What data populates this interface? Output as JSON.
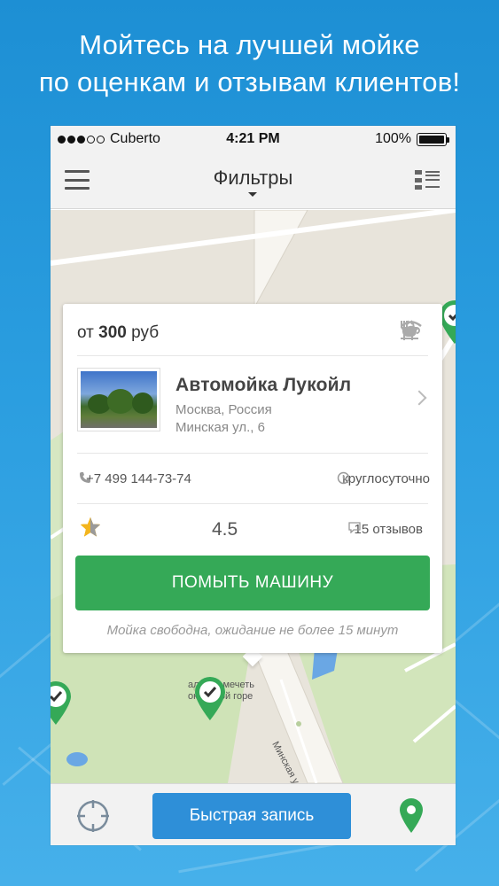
{
  "promo": {
    "line1": "Мойтесь на лучшей мойке",
    "line2": "по оценкам и отзывам клиентов!"
  },
  "statusbar": {
    "carrier": "Cuberto",
    "time": "4:21 PM",
    "battery": "100%",
    "signal_bars_filled": 3,
    "signal_bars_total": 5
  },
  "navbar": {
    "title": "Фильтры"
  },
  "card": {
    "price_prefix": "от",
    "price_value": "300",
    "price_unit": "руб",
    "amenities": [
      "restaurant-icon",
      "cafe-icon",
      "wifi-icon"
    ],
    "name": "Автомойка Лукойл",
    "city": "Москва, Россия",
    "address": "Минская ул., 6",
    "phone": "+7 499 144-73-74",
    "hours": "круглосуточно",
    "rating": "4.5",
    "rating_value": 4.5,
    "rating_max": 5,
    "reviews": "15 отзывов",
    "action_button": "ПОМЫТЬ МАШИНУ",
    "availability": "Мойка свободна, ожидание не более 15 минут"
  },
  "map": {
    "street_label": "Минская ул.",
    "poi_label_1": "альная мечеть",
    "poi_label_2": "оклонной горе"
  },
  "bottombar": {
    "quick_button": "Быстрая запись"
  },
  "colors": {
    "background": "#2b9ee0",
    "green_button": "#35a957",
    "blue_button": "#2e8fd8",
    "star": "#f3b51d",
    "marker": "#35a957"
  }
}
